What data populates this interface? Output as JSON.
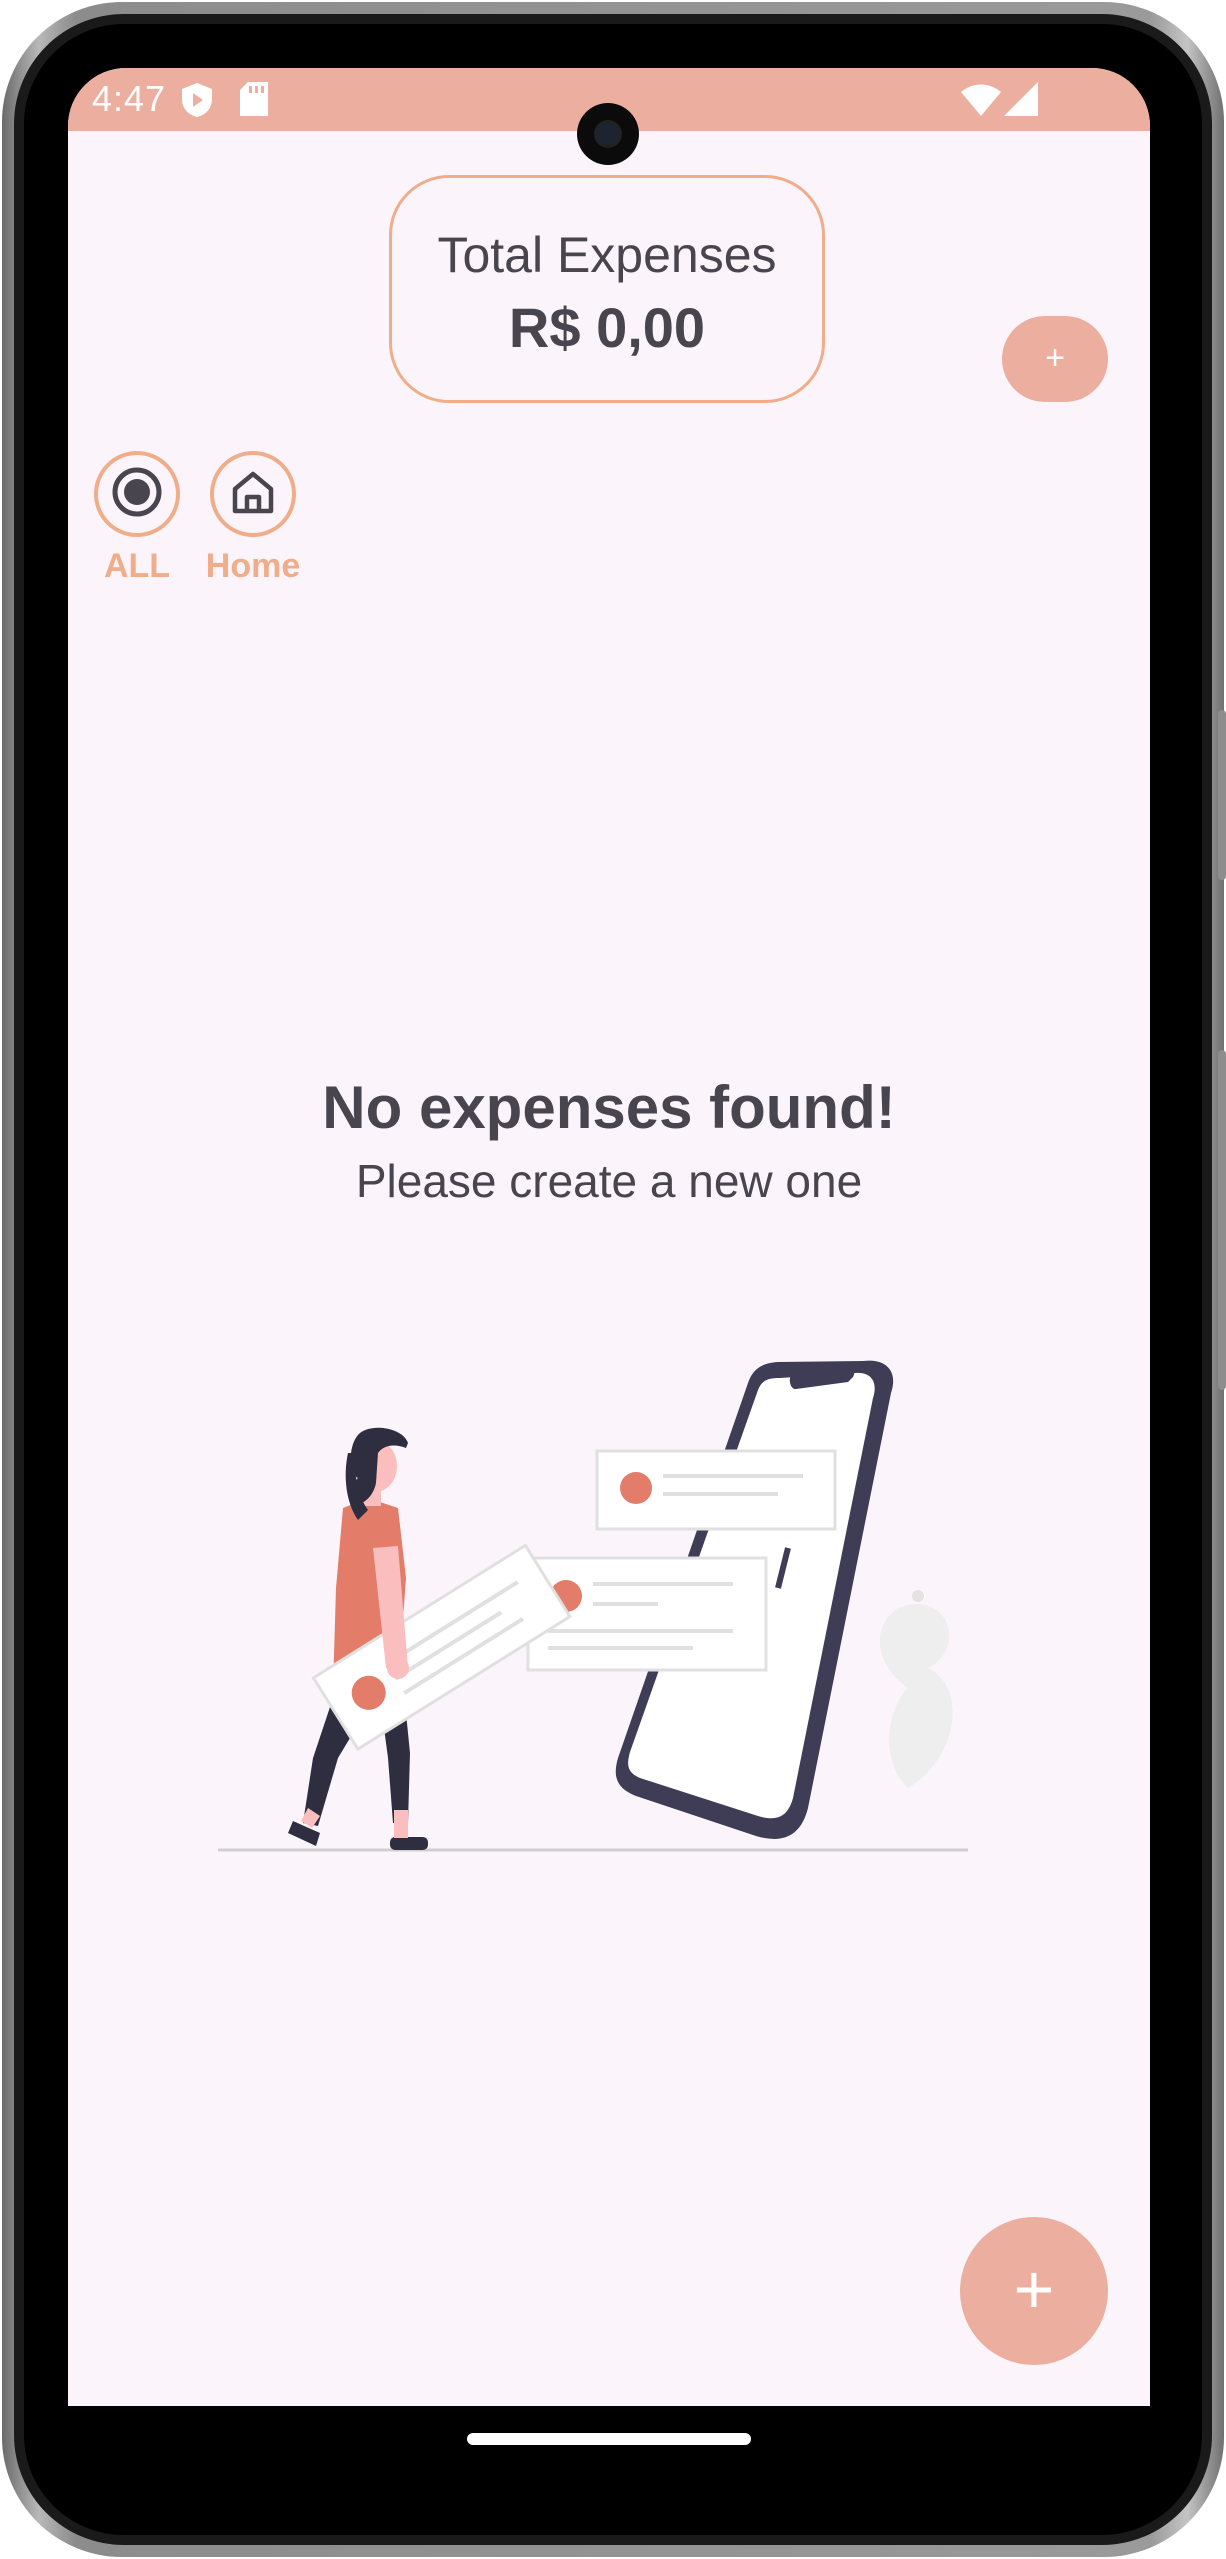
{
  "status_bar": {
    "time": "4:47",
    "icons": [
      "shield-icon",
      "sd-card-icon",
      "wifi-icon",
      "signal-icon"
    ],
    "color": "#ecae9e"
  },
  "summary": {
    "title": "Total Expenses",
    "value": "R$ 0,00"
  },
  "header_add_button": {
    "label": "+"
  },
  "filters": [
    {
      "label": "ALL",
      "icon": "radio-selected-icon"
    },
    {
      "label": "Home",
      "icon": "home-icon"
    }
  ],
  "empty_state": {
    "title": "No expenses found!",
    "subtitle": "Please create a new one",
    "illustration": "woman-carrying-card-phone-illustration"
  },
  "fab": {
    "label": "+"
  },
  "colors": {
    "accent": "#ecae9e",
    "accent_outline": "#f0ad8a",
    "background": "#fcf4fb",
    "text": "#49454f",
    "illustration_red": "#e47c6a"
  }
}
